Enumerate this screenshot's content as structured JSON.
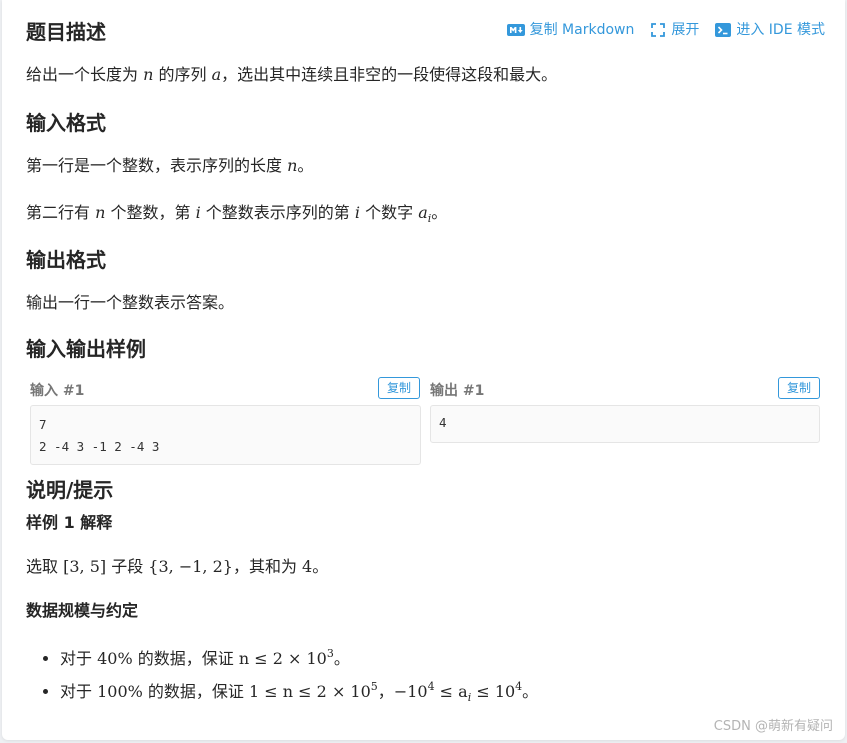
{
  "toolbar": {
    "copy_markdown": "复制 Markdown",
    "expand": "展开",
    "enter_ide": "进入 IDE 模式",
    "accent": "#3498db"
  },
  "description": {
    "title": "题目描述",
    "text_1": "给出一个长度为 ",
    "var_n": "n",
    "text_2": " 的序列 ",
    "var_a": "a",
    "text_3": "，选出其中连续且非空的一段使得这段和最大。"
  },
  "input_format": {
    "title": "输入格式",
    "line1_a": "第一行是一个整数，表示序列的长度 ",
    "line1_var": "n",
    "line1_b": "。",
    "line2_a": "第二行有 ",
    "line2_var_n": "n",
    "line2_b": " 个整数，第 ",
    "line2_var_i": "i",
    "line2_c": " 个整数表示序列的第 ",
    "line2_var_i2": "i",
    "line2_d": " 个数字 ",
    "line2_var_a": "a",
    "line2_sub": "i",
    "line2_e": "。"
  },
  "output_format": {
    "title": "输出格式",
    "text": "输出一行一个整数表示答案。"
  },
  "samples": {
    "title": "输入输出样例",
    "input_label": "输入 #1",
    "output_label": "输出 #1",
    "copy_label": "复制",
    "input_line1": "7",
    "input_line2": "2 -4 3 -1 2 -4 3",
    "output_line1": "4"
  },
  "hint": {
    "title": "说明/提示",
    "sample_title": "样例 1 解释",
    "exp_a": "选取 ",
    "exp_range": "[3, 5]",
    "exp_b": " 子段 ",
    "exp_set": "{3, −1, 2}",
    "exp_c": "，其和为 ",
    "exp_sum": "4",
    "exp_d": "。",
    "limits_title": "数据规模与约定",
    "item1_a": "对于 ",
    "item1_pct": "40%",
    "item1_b": " 的数据，保证 ",
    "item1_math": "n ≤ 2 × 10",
    "item1_sup": "3",
    "item1_c": "。",
    "item2_a": "对于 ",
    "item2_pct": "100%",
    "item2_b": " 的数据，保证 ",
    "item2_math1": "1 ≤ n ≤ 2 × 10",
    "item2_sup1": "5",
    "item2_c": "，",
    "item2_math2a": "−10",
    "item2_sup2": "4",
    "item2_math2b": " ≤ a",
    "item2_sub": "i",
    "item2_math2c": " ≤ 10",
    "item2_sup3": "4",
    "item2_d": "。"
  },
  "watermark": "CSDN @萌新有疑问"
}
